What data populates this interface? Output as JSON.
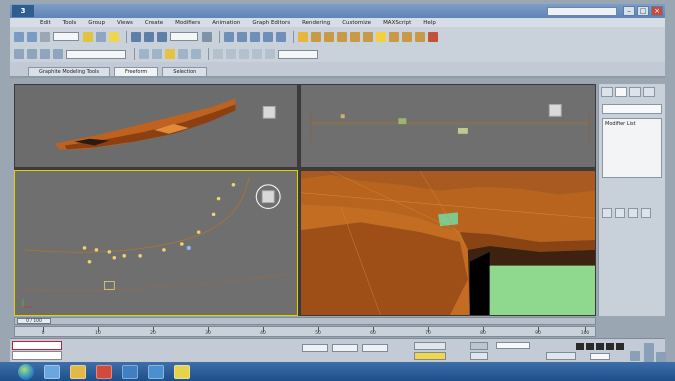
{
  "window": {
    "title_text": "",
    "controls": [
      "–",
      "□",
      "×"
    ]
  },
  "menu": {
    "items": [
      "Edit",
      "Tools",
      "Group",
      "Views",
      "Create",
      "Modifiers",
      "Animation",
      "Graph Editors",
      "Rendering",
      "Customize",
      "MAXScript",
      "Help"
    ]
  },
  "toolbar": {
    "dropdown_1": "",
    "dropdown_2": "",
    "dropdown_3": ""
  },
  "ribbon": {
    "tabs": [
      "Graphite Modeling Tools",
      "Freeform",
      "Selection"
    ]
  },
  "viewports": {
    "top_left_label": "",
    "top_right_label": "",
    "bottom_left_label": "",
    "bottom_right_label": ""
  },
  "command_panel": {
    "list_item": "Modifier List"
  },
  "timeline": {
    "slider_text": "0 / 100",
    "ticks": [
      "0",
      "10",
      "20",
      "30",
      "40",
      "50",
      "60",
      "70",
      "80",
      "90",
      "100"
    ]
  },
  "status": {
    "maxscript": "",
    "line_1": "",
    "line_2": "",
    "auto_key": "",
    "set_key": "",
    "key_filters": ""
  },
  "taskbar": {
    "time": "",
    "date": ""
  },
  "colors": {
    "viewport_bg": "#6f6f6f",
    "terrain_orange": "#c0621f",
    "box_green": "#8ed98e",
    "active_border": "#e4d100"
  }
}
